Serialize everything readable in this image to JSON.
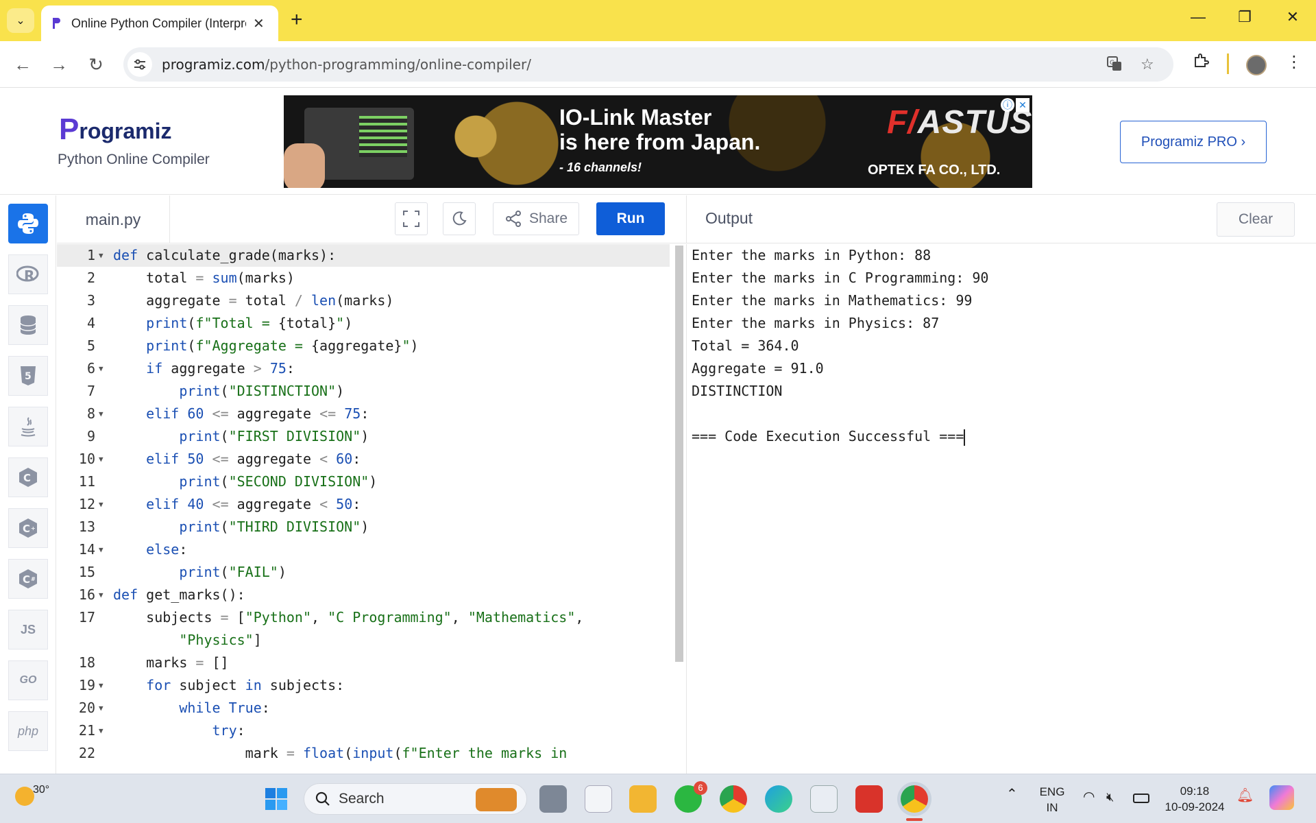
{
  "browser": {
    "tab_title": "Online Python Compiler (Interpreter)",
    "url_domain": "programiz.com",
    "url_path": "/python-programming/online-compiler/"
  },
  "site": {
    "logo_initial": "P",
    "logo_text": "rogramiz",
    "subtitle": "Python Online Compiler",
    "pro_button": "Programiz PRO ›"
  },
  "ad": {
    "line1": "IO-Link Master",
    "line2": "is here from Japan.",
    "line3": "- 16 channels!",
    "brand_red": "F/",
    "brand_rest": "ASTUS",
    "company": "OPTEX FA CO., LTD."
  },
  "languages": [
    "Python",
    "R",
    "SQL",
    "HTML",
    "Java",
    "C",
    "C++",
    "C#",
    "JS",
    "GO",
    "php"
  ],
  "editor": {
    "file_name": "main.py",
    "share_label": "Share",
    "run_label": "Run",
    "line_numbers": [
      "1",
      "2",
      "3",
      "4",
      "5",
      "6",
      "7",
      "8",
      "9",
      "10",
      "11",
      "12",
      "13",
      "14",
      "15",
      "16",
      "17",
      "",
      "18",
      "19",
      "20",
      "21",
      "22"
    ]
  },
  "output": {
    "title": "Output",
    "clear_label": "Clear",
    "lines": [
      "Enter the marks in Python: 88",
      "Enter the marks in C Programming: 90",
      "Enter the marks in Mathematics: 99",
      "Enter the marks in Physics: 87",
      "Total = 364.0",
      "Aggregate = 91.0",
      "DISTINCTION",
      "",
      "=== Code Execution Successful ==="
    ]
  },
  "taskbar": {
    "temperature": "30°",
    "search_placeholder": "Search",
    "whatsapp_badge": "6",
    "lang_top": "ENG",
    "lang_bottom": "IN",
    "time": "09:18",
    "date": "10-09-2024"
  },
  "colors": {
    "tabbar": "#f9e24c",
    "run_button": "#0f5ed8",
    "python_button": "#1a73e8",
    "keyword": "#1a4fb3",
    "string": "#187018"
  }
}
